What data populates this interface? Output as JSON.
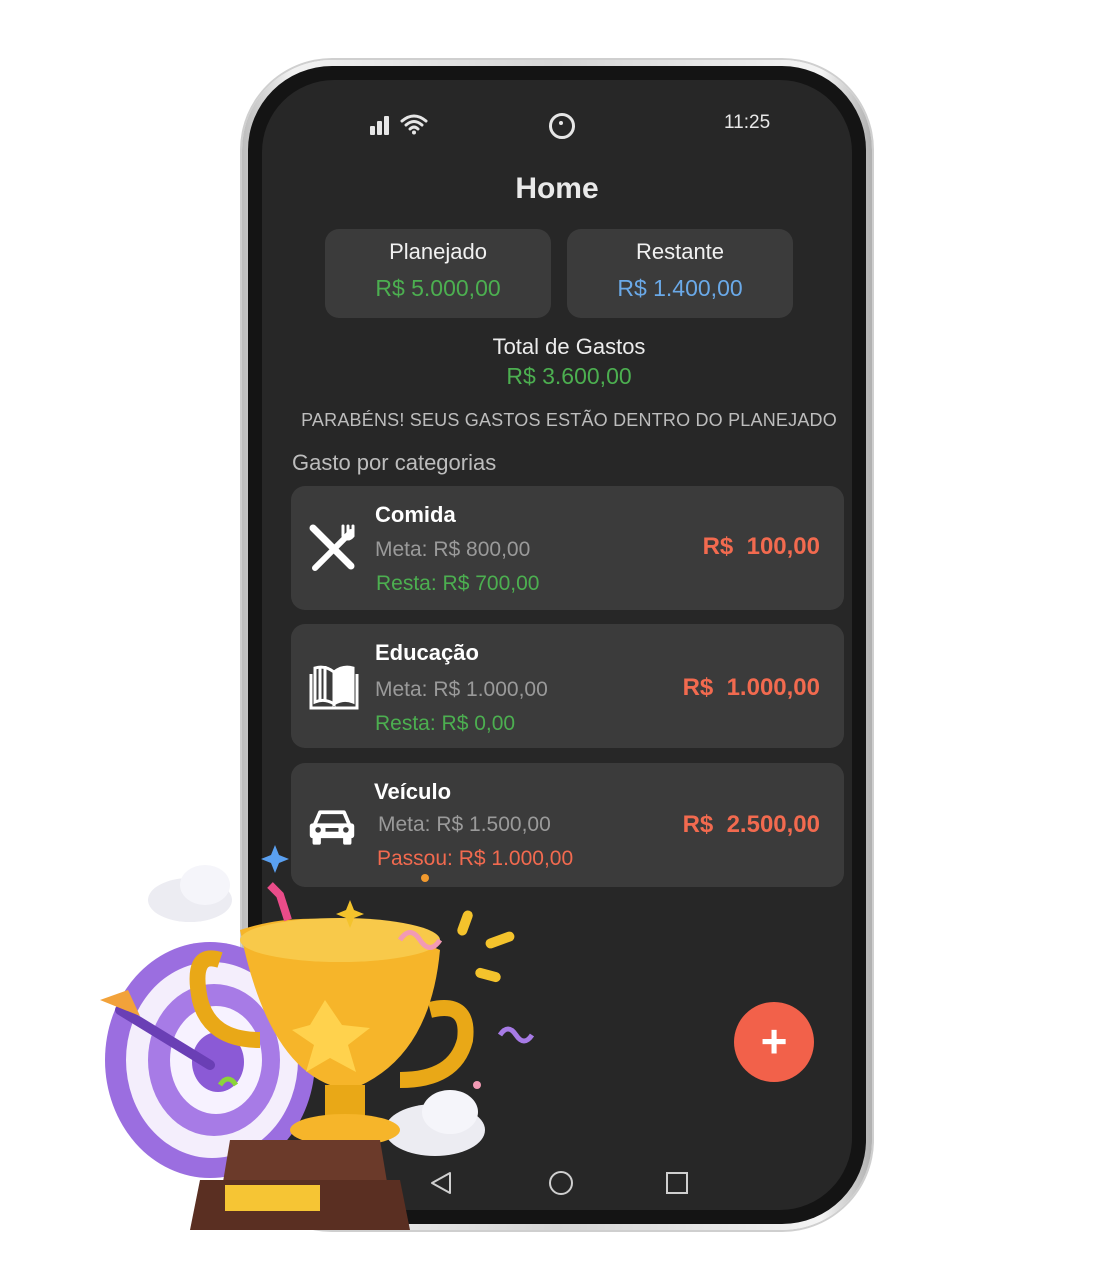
{
  "status_bar": {
    "time": "11:25"
  },
  "header": {
    "title": "Home"
  },
  "summary": {
    "planned": {
      "label": "Planejado",
      "value": "R$ 5.000,00"
    },
    "remaining": {
      "label": "Restante",
      "value": "R$ 1.400,00"
    },
    "total": {
      "label": "Total de Gastos",
      "value": "R$ 3.600,00"
    },
    "message": "PARABÉNS! SEUS GASTOS ESTÃO DENTRO DO PLANEJADO"
  },
  "categories": {
    "section_title": "Gasto por categorias",
    "items": [
      {
        "name": "Comida",
        "goal": "Meta: R$ 800,00",
        "status": "Resta: R$ 700,00",
        "value": "R$  100,00",
        "icon": "fork-knife-icon"
      },
      {
        "name": "Educação",
        "goal": "Meta: R$ 1.000,00",
        "status": "Resta: R$ 0,00",
        "value": "R$  1.000,00",
        "icon": "book-icon"
      },
      {
        "name": "Veículo",
        "goal": "Meta: R$ 1.500,00",
        "status": "Passou: R$ 1.000,00",
        "value": "R$  2.500,00",
        "icon": "car-icon"
      }
    ]
  },
  "fab": {
    "label": "+"
  },
  "colors": {
    "green": "#4caf50",
    "blue": "#6aa9e8",
    "red": "#f26a4f",
    "card": "#3b3b3b",
    "background": "#272727"
  }
}
